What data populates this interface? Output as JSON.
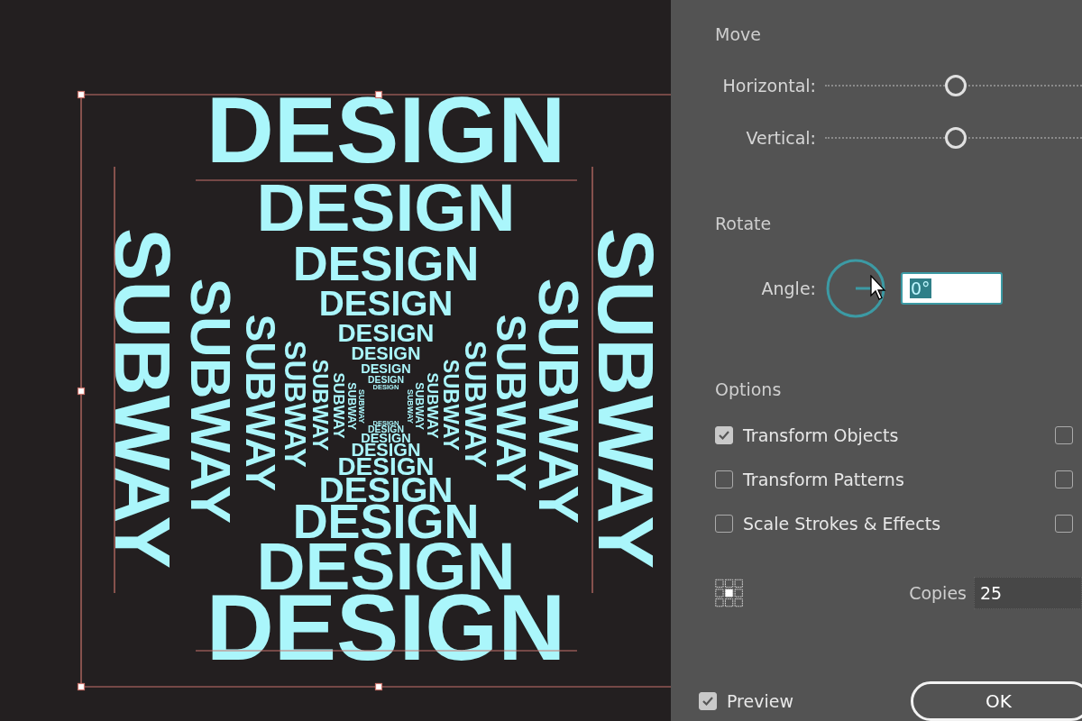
{
  "canvas": {
    "artwork": {
      "top_words": [
        "DESIGN",
        "DESIGN",
        "DESIGN",
        "DESIGN",
        "DESIGN",
        "DESIGN",
        "DESIGN",
        "DESIGN",
        "DESIGN"
      ],
      "left_words": [
        "SUBWAY",
        "SUBWAY",
        "SUBWAY",
        "SUBWAY",
        "SUBWAY",
        "SUBWAY",
        "SUBWAY",
        "SUBWAY"
      ],
      "right_words": [
        "SUBWAY",
        "SUBWAY",
        "SUBWAY",
        "SUBWAY",
        "SUBWAY",
        "SUBWAY",
        "SUBWAY",
        "SUBWAY"
      ],
      "bottom_words": [
        "DESIGN",
        "DESIGN",
        "DESIGN",
        "DESIGN",
        "DESIGN",
        "DESIGN",
        "DESIGN",
        "DESIGN",
        "DESIGN"
      ]
    }
  },
  "dialog": {
    "move": {
      "heading": "Move",
      "sliders": [
        {
          "label": "Horizontal:",
          "level": 0.51
        },
        {
          "label": "Vertical:",
          "level": 0.51
        }
      ]
    },
    "rotate": {
      "heading": "Rotate",
      "angle_label": "Angle:",
      "angle_value": "0°"
    },
    "options": {
      "heading": "Options",
      "checkboxes": [
        {
          "label": "Transform Objects",
          "checked": true,
          "right_checked": false
        },
        {
          "label": "Transform Patterns",
          "checked": false,
          "right_checked": false
        },
        {
          "label": "Scale Strokes & Effects",
          "checked": false,
          "right_checked": false
        }
      ]
    },
    "copies": {
      "label": "Copies",
      "value": "25"
    },
    "preview": {
      "label": "Preview",
      "checked": true
    },
    "buttons": [
      {
        "label": "OK"
      }
    ]
  }
}
